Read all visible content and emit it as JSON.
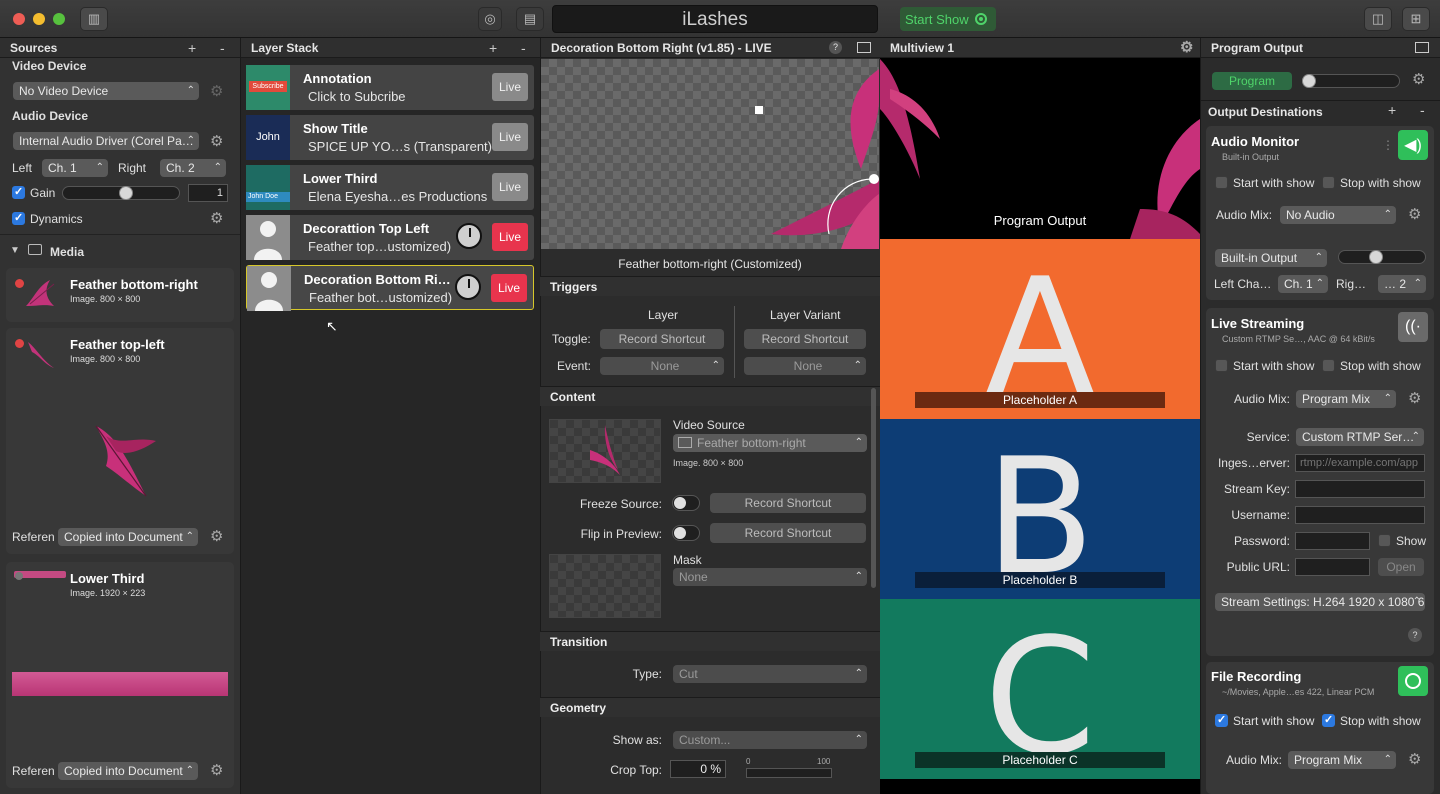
{
  "window": {
    "app_title": "iLashes",
    "start_show_label": "Start Show",
    "colors": {
      "live": "#e8344d",
      "accent": "#2c79e0",
      "start_green": "#4fd46a",
      "selection": "#d6c72a"
    }
  },
  "sources": {
    "header": "Sources",
    "plus": "+",
    "minus": "-",
    "video_device_label": "Video Device",
    "video_device_value": "No Video Device",
    "audio_device_label": "Audio Device",
    "audio_device_value": "Internal Audio Driver (Corel Pa…",
    "left_label": "Left",
    "left_value": "Ch. 1",
    "right_label": "Right",
    "right_value": "Ch. 2",
    "gain_label": "Gain",
    "gain_value": "1",
    "gain_level": 0.55,
    "dynamics_label": "Dynamics",
    "media_label": "Media",
    "media_items": [
      {
        "title": "Feather bottom-right",
        "sub": "Image. 800 × 800"
      },
      {
        "title": "Feather top-left",
        "sub": "Image. 800 × 800",
        "ref_label": "Referen",
        "ref_value": "Copied into Document"
      },
      {
        "title": "Lower Third",
        "sub": "Image. 1920 × 223",
        "ref_label": "Referen",
        "ref_value": "Copied into Document"
      }
    ]
  },
  "layer_stack": {
    "header": "Layer Stack",
    "plus": "+",
    "minus": "-",
    "layers": [
      {
        "title": "Annotation",
        "sub": "Click to Subcribe",
        "live": "Live",
        "thumb_text": "Subscribe"
      },
      {
        "title": "Show Title",
        "sub": "SPICE UP YO…s (Transparent)",
        "live": "Live",
        "thumb_text": "John"
      },
      {
        "title": "Lower Third",
        "sub": "Elena Eyesha…es Productions",
        "live": "Live",
        "thumb_text": "John Doe"
      },
      {
        "title": "Decorattion Top Left",
        "sub": "Feather top…ustomized)",
        "live": "Live"
      },
      {
        "title": "Decoration Bottom Ri…",
        "sub": "Feather bot…ustomized)",
        "live": "Live"
      }
    ]
  },
  "inspector": {
    "header": "Decoration Bottom Right (v1.85) - LIVE",
    "help": "?",
    "preview_caption": "Feather bottom-right (Customized)",
    "triggers": {
      "label": "Triggers",
      "col_layer": "Layer",
      "col_variant": "Layer Variant",
      "toggle_label": "Toggle:",
      "record_shortcut": "Record Shortcut",
      "event_label": "Event:",
      "none": "None"
    },
    "content": {
      "label": "Content",
      "video_source_label": "Video Source",
      "video_source_value": "Feather bottom-right",
      "video_source_sub": "Image. 800 × 800",
      "freeze_label": "Freeze Source:",
      "flip_label": "Flip in Preview:",
      "record_shortcut": "Record Shortcut",
      "mask_label": "Mask",
      "mask_value": "None"
    },
    "transition": {
      "label": "Transition",
      "type_label": "Type:",
      "type_value": "Cut"
    },
    "geometry": {
      "label": "Geometry",
      "show_as_label": "Show as:",
      "show_as_value": "Custom...",
      "crop_top_label": "Crop Top:",
      "crop_top_value": "0 %",
      "scale_min": "0",
      "scale_max": "100"
    }
  },
  "multiview": {
    "header": "Multiview 1",
    "program_label": "Program Output",
    "cells": [
      {
        "letter": "A",
        "label": "Placeholder A",
        "bg": "#f26a2e"
      },
      {
        "letter": "B",
        "label": "Placeholder B",
        "bg": "#0d3d75"
      },
      {
        "letter": "C",
        "label": "Placeholder C",
        "bg": "#127a5e"
      }
    ]
  },
  "program_output": {
    "header": "Program Output",
    "program_button": "Program",
    "dest_header": "Output Destinations",
    "plus": "+",
    "minus": "-",
    "audio_monitor": {
      "title": "Audio Monitor",
      "sub": "Built-in Output",
      "start_with_show": "Start with show",
      "stop_with_show": "Stop with show",
      "audio_mix_label": "Audio Mix:",
      "audio_mix_value": "No Audio",
      "device_value": "Built-in Output",
      "left_label": "Left Cha…",
      "left_value": "Ch. 1",
      "right_label": "Rig…",
      "right_value": "… 2"
    },
    "live_streaming": {
      "title": "Live Streaming",
      "sub": "Custom RTMP Se…, AAC @ 64 kBit/s",
      "start_with_show": "Start with show",
      "stop_with_show": "Stop with show",
      "audio_mix_label": "Audio Mix:",
      "audio_mix_value": "Program Mix",
      "service_label": "Service:",
      "service_value": "Custom RTMP Ser…",
      "ingest_label": "Inges…erver:",
      "ingest_placeholder": "rtmp://example.com/app",
      "stream_key_label": "Stream Key:",
      "username_label": "Username:",
      "password_label": "Password:",
      "show_label": "Show",
      "public_url_label": "Public URL:",
      "open_label": "Open",
      "stream_settings": "Stream Settings: H.264 1920 x 1080 6",
      "help": "?"
    },
    "file_recording": {
      "title": "File Recording",
      "sub": "~/Movies, Apple…es 422, Linear PCM",
      "start_with_show": "Start with show",
      "stop_with_show": "Stop with show",
      "audio_mix_label": "Audio Mix:",
      "audio_mix_value": "Program Mix"
    }
  }
}
